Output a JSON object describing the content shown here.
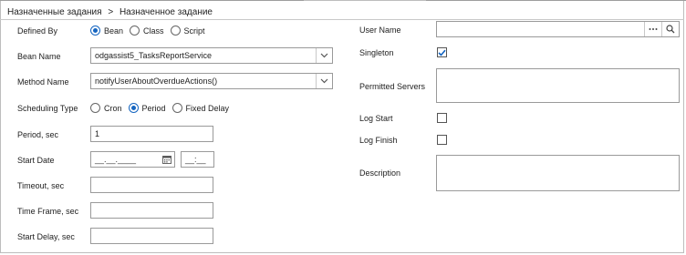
{
  "breadcrumb": {
    "parent": "Назначенные задания",
    "separator": ">",
    "current": "Назначенное задание"
  },
  "form": {
    "defined_by": {
      "label": "Defined By",
      "options": [
        "Bean",
        "Class",
        "Script"
      ],
      "selected": "Bean"
    },
    "bean_name": {
      "label": "Bean Name",
      "value": "odgassist5_TasksReportService"
    },
    "method_name": {
      "label": "Method Name",
      "value": "notifyUserAboutOverdueActions()"
    },
    "scheduling_type": {
      "label": "Scheduling Type",
      "options": [
        "Cron",
        "Period",
        "Fixed Delay"
      ],
      "selected": "Period"
    },
    "period": {
      "label": "Period, sec",
      "value": "1"
    },
    "start_date": {
      "label": "Start Date",
      "date_placeholder": "__.__.____",
      "time_placeholder": "__:__"
    },
    "timeout": {
      "label": "Timeout, sec",
      "value": ""
    },
    "time_frame": {
      "label": "Time Frame, sec",
      "value": ""
    },
    "start_delay": {
      "label": "Start Delay, sec",
      "value": ""
    },
    "user_name": {
      "label": "User Name",
      "value": ""
    },
    "singleton": {
      "label": "Singleton",
      "checked": true
    },
    "permitted_servers": {
      "label": "Permitted Servers",
      "value": ""
    },
    "log_start": {
      "label": "Log Start",
      "checked": false
    },
    "log_finish": {
      "label": "Log Finish",
      "checked": false
    },
    "description": {
      "label": "Description",
      "value": ""
    }
  },
  "colors": {
    "accent": "#1565c0",
    "border": "#9a9a9a"
  }
}
